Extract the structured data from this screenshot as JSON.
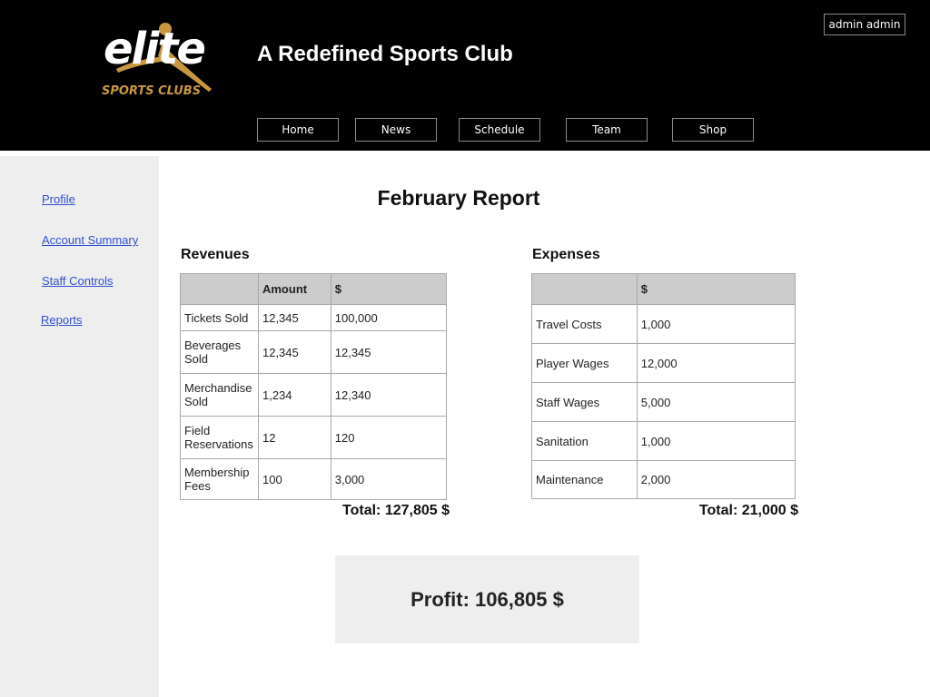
{
  "header": {
    "logo_text": "elite",
    "logo_subtext": "SPORTS CLUBS",
    "title": "A Redefined Sports Club",
    "user_label": "admin admin",
    "nav": [
      {
        "label": "Home"
      },
      {
        "label": "News"
      },
      {
        "label": "Schedule"
      },
      {
        "label": "Team"
      },
      {
        "label": "Shop"
      }
    ]
  },
  "sidebar": {
    "items": [
      {
        "label": "Profile"
      },
      {
        "label": "Account Summary"
      },
      {
        "label": "Staff Controls"
      },
      {
        "label": "Reports"
      }
    ]
  },
  "report": {
    "title": "February Report",
    "revenues": {
      "title": "Revenues",
      "headers": [
        "",
        "Amount",
        "$"
      ],
      "rows": [
        [
          "Tickets Sold",
          "12,345",
          "100,000"
        ],
        [
          "Beverages Sold",
          "12,345",
          "12,345"
        ],
        [
          "Merchandise Sold",
          "1,234",
          "12,340"
        ],
        [
          "Field Reservations",
          "12",
          "120"
        ],
        [
          "Membership Fees",
          "100",
          "3,000"
        ]
      ],
      "total": "Total: 127,805 $"
    },
    "expenses": {
      "title": "Expenses",
      "headers": [
        "",
        "$"
      ],
      "rows": [
        [
          "Travel Costs",
          "1,000"
        ],
        [
          "Player Wages",
          "12,000"
        ],
        [
          "Staff Wages",
          "5,000"
        ],
        [
          "Sanitation",
          "1,000"
        ],
        [
          "Maintenance",
          "2,000"
        ]
      ],
      "total": "Total: 21,000 $"
    },
    "profit": "Profit: 106,805 $"
  },
  "colors": {
    "header_bg": "#000000",
    "logo_accent": "#c9973f",
    "sidebar_bg": "#eeeeee",
    "link": "#2f4fcf",
    "table_header_bg": "#cccccc"
  }
}
